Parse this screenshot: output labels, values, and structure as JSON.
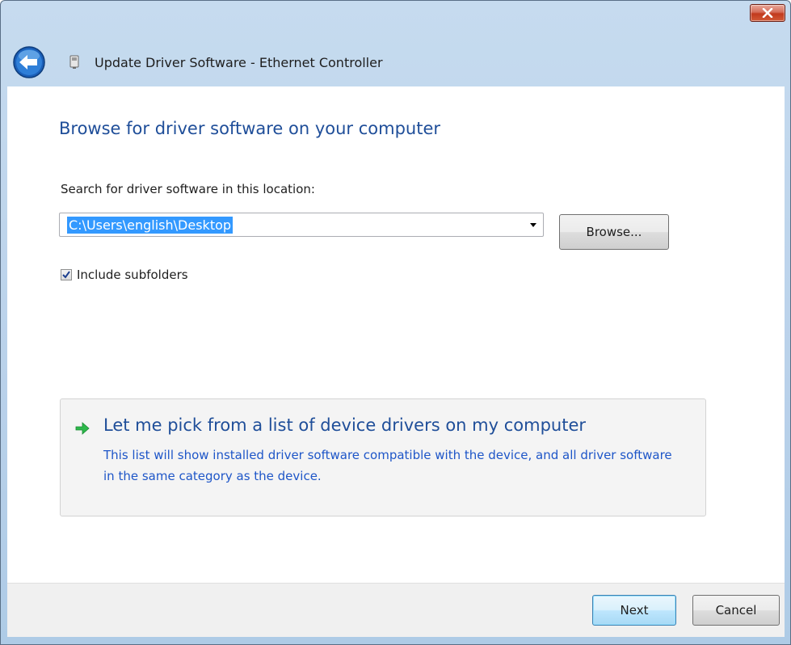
{
  "window": {
    "title": "Update Driver Software - Ethernet Controller",
    "close_icon": "close-x-icon",
    "back_icon": "back-arrow-icon",
    "device_icon": "ethernet-device-icon"
  },
  "main": {
    "heading": "Browse for driver software on your computer",
    "search_label": "Search for driver software in this location:",
    "path_value": "C:\\Users\\english\\Desktop",
    "browse_label": "Browse...",
    "include_subfolders_label": "Include subfolders",
    "include_subfolders_checked": true
  },
  "pick_option": {
    "title": "Let me pick from a list of device drivers on my computer",
    "description": "This list will show installed driver software compatible with the device, and all driver software in the same category as the device.",
    "icon": "green-arrow-icon"
  },
  "footer": {
    "next_label": "Next",
    "cancel_label": "Cancel"
  },
  "colors": {
    "heading": "#1f4e99",
    "link_description": "#1e56c8",
    "selection": "#3399ff",
    "close_button": "#c1391d",
    "arrow_green": "#2db84b"
  }
}
